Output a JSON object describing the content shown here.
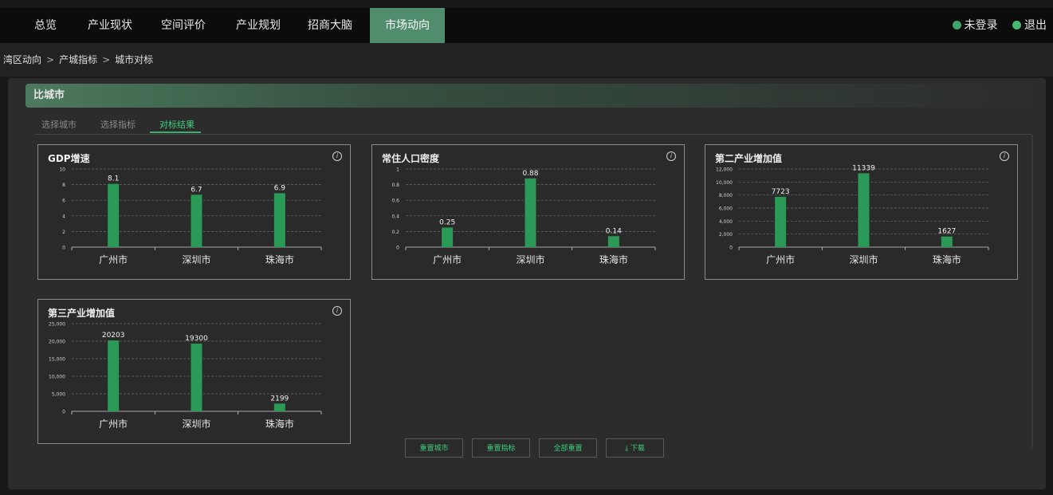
{
  "nav": {
    "items": [
      {
        "label": "总览",
        "active": false
      },
      {
        "label": "产业现状",
        "active": false
      },
      {
        "label": "空间评价",
        "active": false
      },
      {
        "label": "产业规划",
        "active": false
      },
      {
        "label": "招商大脑",
        "active": false
      },
      {
        "label": "市场动向",
        "active": true
      }
    ],
    "login_label": "未登录",
    "logout_label": "退出"
  },
  "breadcrumb": {
    "items": [
      "湾区动向",
      "产城指标",
      "城市对标"
    ],
    "separator": ">"
  },
  "section": {
    "title": "比城市"
  },
  "tabs": [
    {
      "label": "选择城市",
      "active": false
    },
    {
      "label": "选择指标",
      "active": false
    },
    {
      "label": "对标结果",
      "active": true
    }
  ],
  "info_glyph": "i",
  "colors": {
    "accent": "#3fcf7c",
    "bar": "#2a9a56",
    "active_nav": "#4f8d6c"
  },
  "chart_data": [
    {
      "type": "bar",
      "title": "GDP增速",
      "categories": [
        "广州市",
        "深圳市",
        "珠海市"
      ],
      "values": [
        8.1,
        6.7,
        6.9
      ],
      "value_labels": [
        "8.1",
        "6.7",
        "6.9"
      ],
      "ylim": [
        0,
        10
      ],
      "yticks": [
        "0",
        "2",
        "4",
        "6",
        "8",
        "10"
      ],
      "grid": true
    },
    {
      "type": "bar",
      "title": "常住人口密度",
      "categories": [
        "广州市",
        "深圳市",
        "珠海市"
      ],
      "values": [
        0.25,
        0.88,
        0.14
      ],
      "value_labels": [
        "0.25",
        "0.88",
        "0.14"
      ],
      "ylim": [
        0,
        1
      ],
      "yticks": [
        "0",
        "0.2",
        "0.4",
        "0.6",
        "0.8",
        "1"
      ],
      "grid": true
    },
    {
      "type": "bar",
      "title": "第二产业增加值",
      "categories": [
        "广州市",
        "深圳市",
        "珠海市"
      ],
      "values": [
        7723,
        11339,
        1627
      ],
      "value_labels": [
        "7723",
        "11339",
        "1627"
      ],
      "ylim": [
        0,
        12000
      ],
      "yticks": [
        "0",
        "2,000",
        "4,000",
        "6,000",
        "8,000",
        "10,000",
        "12,000"
      ],
      "grid": true
    },
    {
      "type": "bar",
      "title": "第三产业增加值",
      "categories": [
        "广州市",
        "深圳市",
        "珠海市"
      ],
      "values": [
        20203,
        19300,
        2199
      ],
      "value_labels": [
        "20203",
        "19300",
        "2199"
      ],
      "ylim": [
        0,
        25000
      ],
      "yticks": [
        "0",
        "5,000",
        "10,000",
        "15,000",
        "20,000",
        "25,000"
      ],
      "grid": true
    }
  ],
  "buttons": {
    "reset_city": "重置城市",
    "reset_indicator": "重置指标",
    "reset_all": "全部重置",
    "download": "下载",
    "download_glyph": "⤓"
  }
}
